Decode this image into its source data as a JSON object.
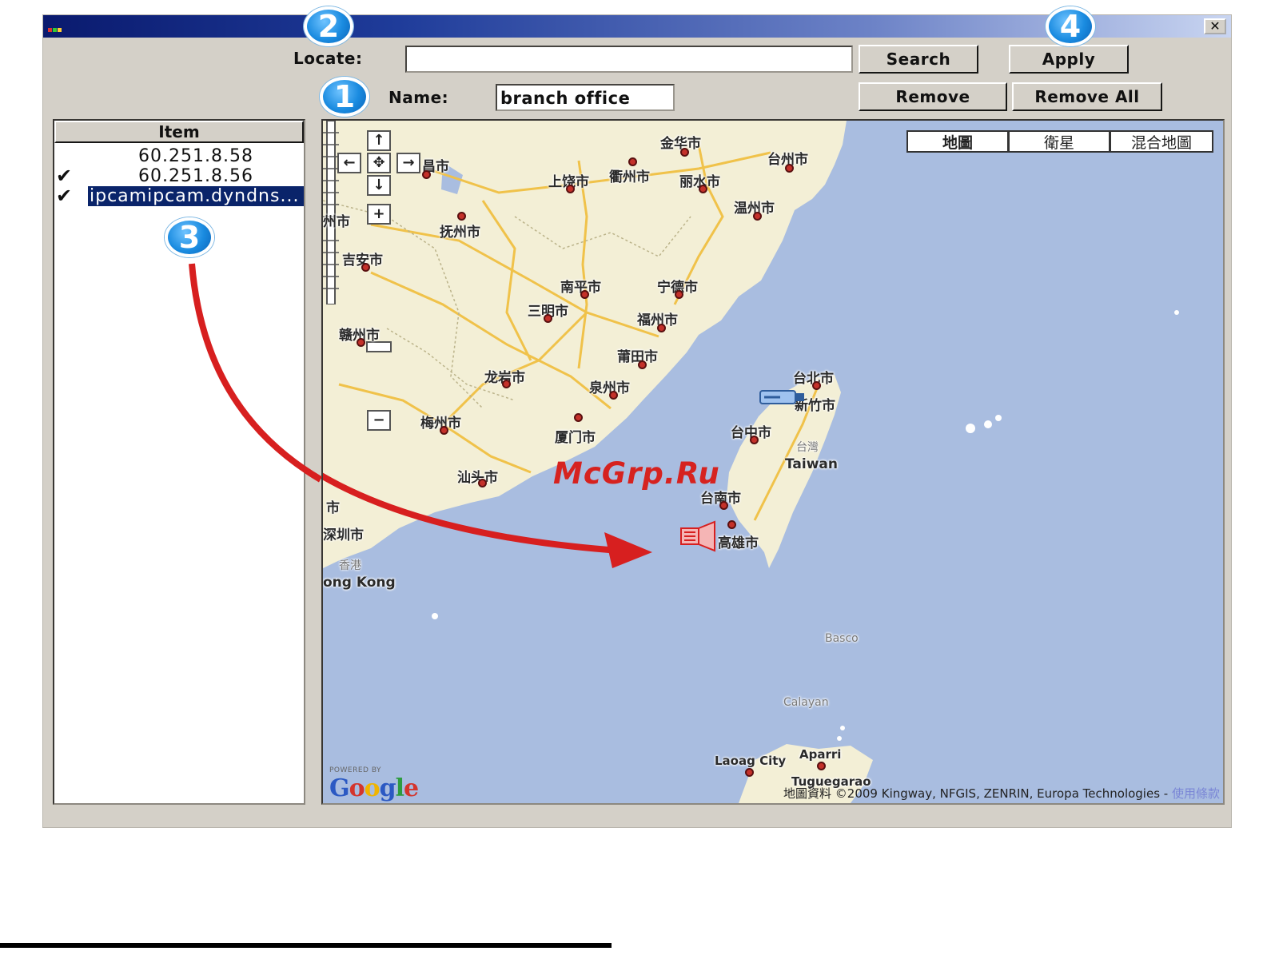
{
  "window": {
    "close_glyph": "✕",
    "app_icon": "app-icon"
  },
  "toolbar": {
    "locate_label": "Locate:",
    "locate_value": "",
    "search_label": "Search",
    "apply_label": "Apply",
    "name_label": "Name:",
    "name_value": "branch office",
    "remove_label": "Remove",
    "remove_all_label": "Remove All"
  },
  "item_list": {
    "header": "Item",
    "rows": [
      {
        "text": "60.251.8.58",
        "checked": false,
        "selected": false
      },
      {
        "text": "60.251.8.56",
        "checked": true,
        "selected": false
      },
      {
        "text": "ipcamipcam.dyndns...",
        "checked": true,
        "selected": true
      }
    ]
  },
  "map": {
    "types": [
      "地圖",
      "衛星",
      "混合地圖"
    ],
    "active_type": "地圖",
    "nav": {
      "up": "↑",
      "left": "←",
      "center": "✥",
      "right": "→",
      "down": "↓",
      "zoom_in": "+",
      "zoom_out": "−"
    },
    "places": [
      {
        "name": "金华市",
        "kind": "city"
      },
      {
        "name": "台州市",
        "kind": "city"
      },
      {
        "name": "昌市",
        "kind": "city"
      },
      {
        "name": "上饶市",
        "kind": "city"
      },
      {
        "name": "衢州市",
        "kind": "city"
      },
      {
        "name": "丽水市",
        "kind": "city"
      },
      {
        "name": "温州市",
        "kind": "city"
      },
      {
        "name": "抚州市",
        "kind": "city"
      },
      {
        "name": "吉安市",
        "kind": "city"
      },
      {
        "name": "南平市",
        "kind": "city"
      },
      {
        "name": "宁德市",
        "kind": "city"
      },
      {
        "name": "三明市",
        "kind": "city"
      },
      {
        "name": "福州市",
        "kind": "city"
      },
      {
        "name": "赣州市",
        "kind": "city"
      },
      {
        "name": "莆田市",
        "kind": "city"
      },
      {
        "name": "龙岩市",
        "kind": "city"
      },
      {
        "name": "泉州市",
        "kind": "city"
      },
      {
        "name": "梅州市",
        "kind": "city"
      },
      {
        "name": "厦门市",
        "kind": "city"
      },
      {
        "name": "汕头市",
        "kind": "city"
      },
      {
        "name": "台北市",
        "kind": "city"
      },
      {
        "name": "新竹市",
        "kind": "city"
      },
      {
        "name": "台中市",
        "kind": "city"
      },
      {
        "name": "台灣",
        "kind": "region"
      },
      {
        "name": "Taiwan",
        "kind": "region"
      },
      {
        "name": "台南市",
        "kind": "city"
      },
      {
        "name": "高雄市",
        "kind": "city"
      },
      {
        "name": "市",
        "kind": "city"
      },
      {
        "name": "深圳市",
        "kind": "city"
      },
      {
        "name": "香港",
        "kind": "region"
      },
      {
        "name": "ong Kong",
        "kind": "region"
      },
      {
        "name": "州市",
        "kind": "city"
      },
      {
        "name": "Basco",
        "kind": "small"
      },
      {
        "name": "Calayan",
        "kind": "small"
      },
      {
        "name": "Laoag City",
        "kind": "city"
      },
      {
        "name": "Aparri",
        "kind": "city"
      },
      {
        "name": "Tuguegarao",
        "kind": "city"
      }
    ],
    "powered_by": "POWERED BY",
    "google": "Google",
    "copyright": "地圖資料 ©2009 Kingway, NFGIS, ZENRIN, Europa Technologies -",
    "terms": "使用條款",
    "watermark": "McGrp.Ru",
    "device_icons": [
      "camera-icon",
      "speaker-icon"
    ]
  },
  "callouts": [
    "1",
    "2",
    "3",
    "4"
  ],
  "colors": {
    "sea": "#a9bde0",
    "land": "#f3efd6",
    "selection": "#0a246a",
    "arrow": "#d71f1f",
    "callout": "#1a8be0"
  }
}
